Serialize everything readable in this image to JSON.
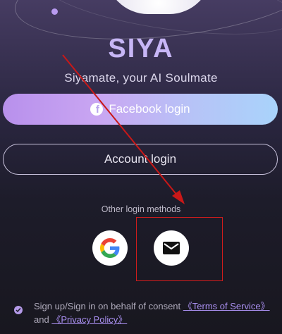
{
  "app": {
    "name": "SIYA",
    "tagline": "Siyamate, your AI Soulmate"
  },
  "buttons": {
    "facebook_label": "Facebook login",
    "account_label": "Account login"
  },
  "other_methods": {
    "label": "Other login methods",
    "google_icon": "google-icon",
    "email_icon": "mail-icon"
  },
  "consent": {
    "prefix": "Sign up/Sign in on behalf of consent",
    "terms_link": "《Terms of Service》",
    "and": "and",
    "privacy_link": "《Privacy Policy》"
  },
  "colors": {
    "accent": "#b99bf0",
    "annotation_red": "#d01c1c"
  }
}
